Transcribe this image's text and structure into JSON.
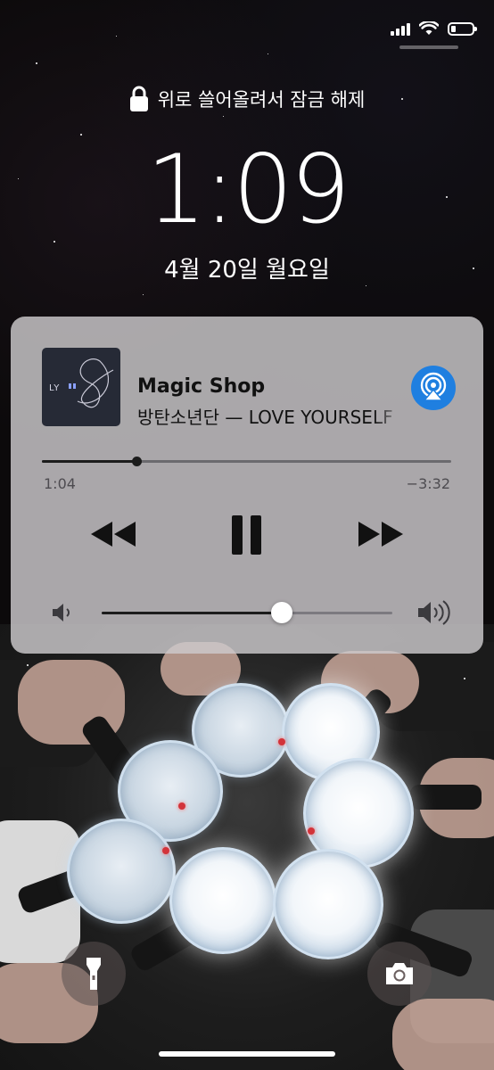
{
  "status_bar": {
    "signal": "signal-icon",
    "wifi": "wifi-icon",
    "battery": "battery-low-icon"
  },
  "lock_screen": {
    "unlock_hint": "위로 쓸어올려서 잠금 해제",
    "time": "1:09",
    "date": "4월 20일 월요일"
  },
  "now_playing": {
    "album_art_text": "LY",
    "title": "Magic Shop",
    "artist_album": "방탄소년단 — LOVE YOURSELF",
    "elapsed": "1:04",
    "remaining": "−3:32",
    "progress_fraction": 0.23,
    "volume_fraction": 0.62,
    "accent_color": "#1f7fe0",
    "controls": [
      "rewind-icon",
      "pause-icon",
      "fast-forward-icon",
      "airplay-icon",
      "volume-low-icon",
      "volume-high-icon"
    ]
  },
  "quick_actions": [
    "flashlight-icon",
    "camera-icon"
  ]
}
